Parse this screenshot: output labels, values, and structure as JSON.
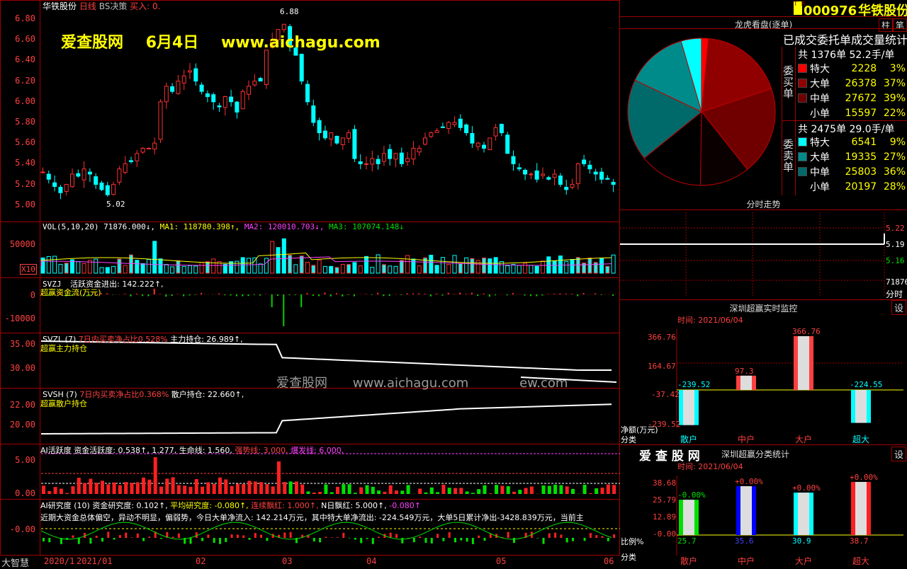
{
  "colors": {
    "up": "#ff3030",
    "down": "#00ffff",
    "grid": "#a00000",
    "bg": "#000000"
  },
  "main": {
    "header_title": "华铁股份",
    "header_period": "日线",
    "header_indicator": "BS决策",
    "header_buy": "买入: 0.",
    "watermark_site": "爱查股网",
    "watermark_date": "6月4日",
    "watermark_url": "www.aichagu.com",
    "high_label": "6.88",
    "low_label": "5.02",
    "y_labels": [
      "6.80",
      "6.60",
      "6.40",
      "6.20",
      "6.00",
      "5.80",
      "5.60",
      "5.40",
      "5.20",
      "5.00"
    ]
  },
  "vol": {
    "name": "VOL(5,10,20)",
    "value": "71876.000↓,",
    "ma1": "MA1: 118780.398↑,",
    "ma2": "MA2: 120010.703↓,",
    "ma3": "MA3: 107074.148↓",
    "y_label": "50000",
    "unit": "X10"
  },
  "svzj": {
    "name": "SVZJ",
    "desc": "活跃资金进出: 142.222↑,",
    "sub": "超赢资金流(万元)",
    "y0": "0",
    "y1": "-10000"
  },
  "svzl": {
    "name": "SVZL (7)",
    "desc": "7日内买卖净占比0.528%",
    "desc2": "主力持仓: 26.989↑,",
    "sub": "超赢主力持仓",
    "y0": "35.00",
    "y1": "30.00",
    "wm_site": "爱查股网",
    "wm_url": "www.aichagu.com",
    "wm_tail": "ew.com"
  },
  "svsh": {
    "name": "SVSH (7)",
    "desc": "7日内买卖净占比0.368%",
    "desc2": "散户持仓: 22.660↑,",
    "sub": "超赢散户持仓",
    "y0": "22.00",
    "y1": "20.00"
  },
  "ai": {
    "name": "AI活跃度",
    "desc": "资金活跃度: 0.538↑,",
    "v2": "1.277,",
    "v3": "生命线: 1.560,",
    "v4": "强势线: 3.000,",
    "v5": "爆发线: 6.000,",
    "y0": "5.00",
    "y1": "0.00"
  },
  "research": {
    "name": "AI研究度 (10)",
    "d1": "资金研究度: 0.102↑,",
    "d2": "平均研究度: -0.080↑,",
    "d3": "连续飘红: 1.000↑,",
    "d4": "N日飘红: 5.000↑,",
    "d5": "-0.080↑",
    "comment": "近期大资金总体偏空，异动不明显，偏弱势，今日大单净流入: 142.214万元，其中特大单净流出: -224.549万元，大单5日累计净出-3428.839万元，当前主",
    "y0": "-0.00"
  },
  "left_tag": "大智慧",
  "x_labels": [
    "2020/1",
    "2021/01",
    "02",
    "03",
    "04",
    "05",
    "06"
  ],
  "right": {
    "code": "000976",
    "name": "华铁股份",
    "btn_pillar": "柱",
    "btn_note": "笔",
    "lhb_title": "龙虎看盘(逐单)",
    "stat_title": "已成交委托单成交量统计",
    "buy": {
      "side_label": "委买单",
      "summary": "共 1376单 52.2手/单",
      "rows": [
        {
          "k": "特大",
          "v": "2228",
          "p": "3%",
          "c": "#ff0000"
        },
        {
          "k": "大单",
          "v": "26378",
          "p": "37%",
          "c": "#900000"
        },
        {
          "k": "中单",
          "v": "27672",
          "p": "39%",
          "c": "#700000"
        },
        {
          "k": "小单",
          "v": "15597",
          "p": "22%",
          "c": "#000000"
        }
      ]
    },
    "sell": {
      "side_label": "委卖单",
      "summary": "共 2475单 29.0手/单",
      "rows": [
        {
          "k": "特大",
          "v": "6541",
          "p": "9%",
          "c": "#00ffff"
        },
        {
          "k": "大单",
          "v": "19335",
          "p": "27%",
          "c": "#008b8b"
        },
        {
          "k": "中单",
          "v": "25803",
          "p": "36%",
          "c": "#006a6a"
        },
        {
          "k": "小单",
          "v": "20197",
          "p": "28%",
          "c": "#000000"
        }
      ]
    },
    "pie": [
      {
        "v": 3,
        "c": "#ff0000"
      },
      {
        "v": 37,
        "c": "#900000"
      },
      {
        "v": 39,
        "c": "#700000"
      },
      {
        "v": 22,
        "c": "#0a0000"
      },
      {
        "v": 28,
        "c": "#000000"
      },
      {
        "v": 36,
        "c": "#006a6a"
      },
      {
        "v": 27,
        "c": "#008b8b"
      },
      {
        "v": 9,
        "c": "#00ffff"
      }
    ],
    "intraday_title": "分时走势",
    "intraday_y": [
      "5.22",
      "5.19",
      "5.16"
    ],
    "intraday_vol": "71876",
    "intraday_tag": "分时",
    "monitor_title": "深圳超赢实时监控",
    "monitor_btn": "设",
    "monitor_date": "时间: 2021/06/04",
    "monitor_y": [
      "366.76",
      "164.67",
      "-37.42",
      "-239.52"
    ],
    "monitor_bars": [
      {
        "cat": "散户",
        "v": -239.52,
        "c": "#00ffff"
      },
      {
        "cat": "中户",
        "v": 97.3,
        "c": "#ff4040"
      },
      {
        "cat": "大户",
        "v": 366.76,
        "c": "#ff4040"
      },
      {
        "cat": "超大",
        "v": -224.55,
        "c": "#00ffff"
      }
    ],
    "monitor_unit": "净额(万元)",
    "monitor_cat": "分类",
    "class_site": "爱 查 股 网",
    "class_title": "深圳超赢分类统计",
    "class_btn": "设",
    "class_date": "时间: 2021/06/04",
    "class_y": [
      "38.68",
      "25.79",
      "12.89",
      "-0.00"
    ],
    "class_bars": [
      {
        "cat": "散户",
        "v": 25.7,
        "top": "-0.00%",
        "bot": "25.7",
        "c": "#00e000"
      },
      {
        "cat": "中户",
        "v": 35.6,
        "top": "+0.00%",
        "bot": "35.6",
        "c": "#0000ff"
      },
      {
        "cat": "大户",
        "v": 30.9,
        "top": "+0.00%",
        "bot": "30.9",
        "c": "#00ffff"
      },
      {
        "cat": "超大",
        "v": 38.7,
        "top": "+0.00%",
        "bot": "38.7",
        "c": "#ff2020"
      }
    ],
    "class_unit": "比例%",
    "class_cat": "分类"
  }
}
